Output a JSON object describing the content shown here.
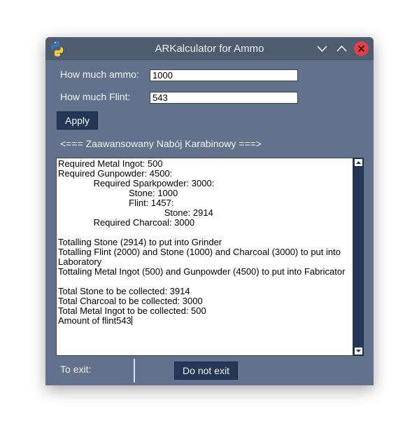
{
  "window": {
    "title": "ARKalculator for Ammo"
  },
  "form": {
    "ammo_label": "How much ammo:",
    "ammo_value": "1000",
    "flint_label": "How much Flint:",
    "flint_value": "543",
    "apply_label": "Apply"
  },
  "ammo_type": "<=== Zaawansowany Nabój Karabinowy ===>",
  "output": {
    "lines": [
      "Required Metal Ingot: 500",
      "Required Gunpowder: 4500:",
      "              Required Sparkpowder: 3000:",
      "                            Stone: 1000",
      "                            Flint: 1457:",
      "                                          Stone: 2914",
      "              Required Charcoal: 3000",
      "",
      "Totalling Stone (2914) to put into Grinder",
      "Totalling Flint (2000) and Stone (1000) and Charcoal (3000) to put into Laboratory",
      "Tottaling Metal Ingot (500) and Gunpowder (4500) to put into Fabricator",
      "",
      "Total Stone to be collected: 3914",
      "Total Charcoal to be collected: 3000",
      "Total Metal Ingot to be collected: 500",
      "Amount of flint543"
    ]
  },
  "footer": {
    "exit_label": "To exit:",
    "no_exit_label": "Do not exit"
  },
  "icons": {
    "app": "python-logo-icon",
    "minimize": "chevron-down-icon",
    "maximize": "chevron-up-icon",
    "close": "close-icon"
  },
  "colors": {
    "window_bg": "#62728c",
    "titlebar_bg": "#4f5b6e",
    "button_bg": "#253756",
    "close_red": "#e0404a"
  }
}
